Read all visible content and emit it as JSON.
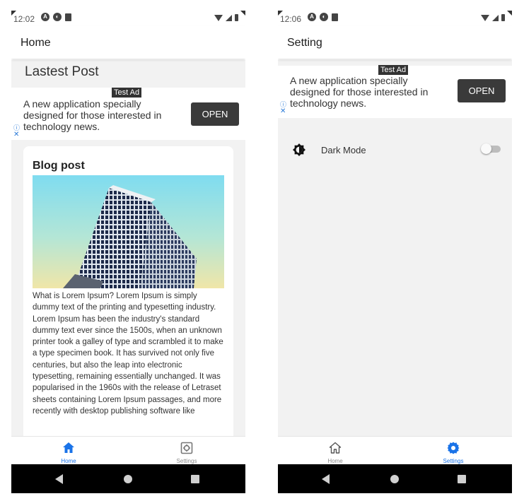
{
  "colors": {
    "accent": "#1a73e8",
    "inactive": "#8a8a8a",
    "content_bg": "#f2f2f2",
    "ad_button": "#3a3a3a",
    "system_nav": "#000000"
  },
  "screens": [
    {
      "status_time": "12:02",
      "status_icons": [
        "android-auto-icon",
        "notification-icon",
        "sd-card-icon",
        "wifi-icon",
        "signal-icon",
        "battery-icon"
      ],
      "title": "Home",
      "section_heading": "Lastest Post",
      "ad": {
        "badge": "Test Ad",
        "text": "A new application specially designed for those interested in technology news.",
        "button": "OPEN",
        "info": "ⓘ",
        "close": "✕"
      },
      "post": {
        "title": "Blog post",
        "image_icon": "building-photo",
        "body": "What is Lorem Ipsum? Lorem Ipsum is simply dummy text of the printing and typesetting industry. Lorem Ipsum has been the industry's standard dummy text ever since the 1500s, when an unknown printer took a galley of type and scrambled it to make a type specimen book. It has survived not only five centuries, but also the leap into electronic typesetting, remaining essentially unchanged. It was popularised in the 1960s with the release of Letraset sheets containing Lorem Ipsum passages, and more recently with desktop publishing software like"
      },
      "nav": [
        {
          "label": "Home",
          "icon": "home-filled-icon",
          "active": true
        },
        {
          "label": "Settings",
          "icon": "settings-outline-icon",
          "active": false
        }
      ]
    },
    {
      "status_time": "12:06",
      "status_icons": [
        "android-auto-icon",
        "notification-icon",
        "sd-card-icon",
        "wifi-icon",
        "signal-icon",
        "battery-icon"
      ],
      "title": "Setting",
      "ad": {
        "badge": "Test Ad",
        "text": "A new application specially designed for those interested in technology news.",
        "button": "OPEN",
        "info": "ⓘ",
        "close": "✕"
      },
      "settings": [
        {
          "label": "Dark Mode",
          "icon": "brightness-icon",
          "toggle_on": false
        }
      ],
      "nav": [
        {
          "label": "Home",
          "icon": "home-outline-icon",
          "active": false
        },
        {
          "label": "Settings",
          "icon": "settings-filled-icon",
          "active": true
        }
      ]
    }
  ]
}
